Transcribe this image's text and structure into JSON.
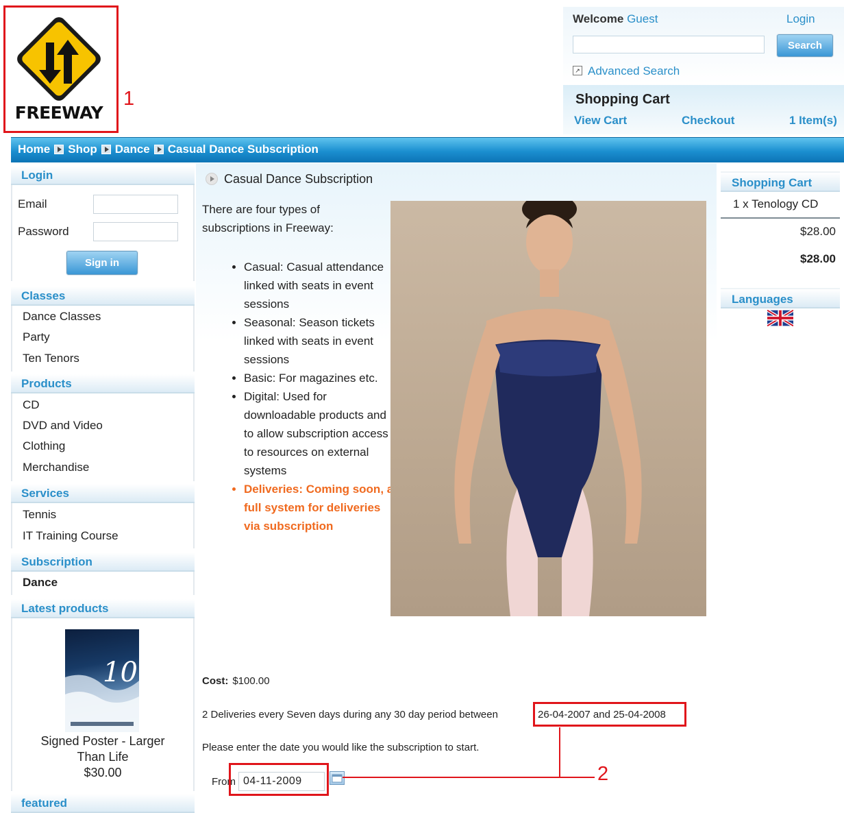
{
  "logo": {
    "text": "FREEWAY"
  },
  "callouts": {
    "one": "1",
    "two": "2"
  },
  "header": {
    "welcome_label": "Welcome",
    "welcome_user": "Guest",
    "login_link": "Login",
    "search_placeholder": "",
    "search_button": "Search",
    "advanced_search": "Advanced Search",
    "cart_title": "Shopping Cart",
    "view_cart": "View Cart",
    "checkout": "Checkout",
    "items": "1 Item(s)"
  },
  "breadcrumb": [
    "Home",
    "Shop",
    "Dance",
    "Casual Dance Subscription"
  ],
  "sidebar": {
    "login": {
      "title": "Login",
      "email_label": "Email",
      "password_label": "Password",
      "sign_in": "Sign in"
    },
    "classes": {
      "title": "Classes",
      "items": [
        "Dance Classes",
        "Party",
        "Ten Tenors"
      ]
    },
    "products": {
      "title": "Products",
      "items": [
        "CD",
        "DVD and Video",
        "Clothing",
        "Merchandise"
      ]
    },
    "services": {
      "title": "Services",
      "items": [
        "Tennis",
        "IT Training Course"
      ]
    },
    "subscription": {
      "title": "Subscription",
      "items": [
        "Dance"
      ]
    },
    "latest": {
      "title": "Latest products",
      "poster_number": "10",
      "product_name": "Signed Poster - Larger Than Life",
      "product_price": "$30.00"
    },
    "featured": {
      "title": "featured"
    }
  },
  "product": {
    "title": "Casual Dance Subscription",
    "intro": "There are four types of subscriptions in Freeway:",
    "bullets": [
      "Casual: Casual attendance linked with seats in event sessions",
      "Seasonal: Season tickets linked with seats in event sessions",
      "Basic: For magazines etc.",
      "Digital: Used for downloadable products and to allow subscription access to resources on external systems",
      "Deliveries: Coming soon, a full system for deliveries via subscription"
    ],
    "cost_label": "Cost:",
    "cost_value": "$100.00",
    "deliveries_text": "2 Deliveries every Seven days during any 30 day period between",
    "date_range": "26-04-2007 and 25-04-2008",
    "enter_date_text": "Please enter the date you would like the subscription to start.",
    "from_label": "From",
    "start_date": "04-11-2009"
  },
  "right": {
    "cart_title": "Shopping Cart",
    "cart_line": "1 x Tenology CD",
    "cart_price": "$28.00",
    "cart_total": "$28.00",
    "languages_title": "Languages",
    "language_icon": "uk-flag-icon"
  },
  "colors": {
    "accent": "#2a8fc9",
    "highlight": "#f06a1f",
    "annotation": "#e0151b",
    "breadcrumb_bar": "#1b8fd0"
  }
}
